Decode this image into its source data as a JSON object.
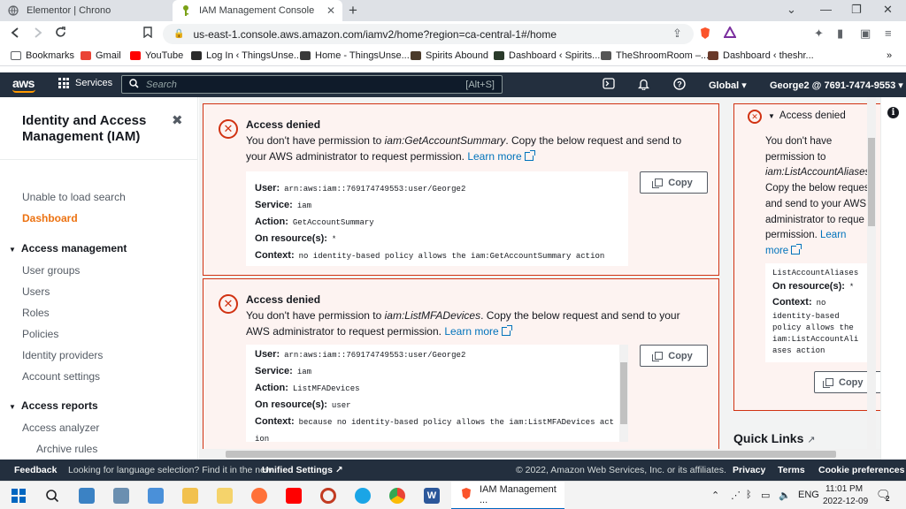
{
  "browser": {
    "tabs": [
      {
        "title": "Elementor | Chrono",
        "active": false
      },
      {
        "title": "IAM Management Console",
        "active": true
      }
    ],
    "new_tab": "+",
    "url": "us-east-1.console.aws.amazon.com/iamv2/home?region=ca-central-1#/home",
    "bookmarks": [
      {
        "label": "Bookmarks",
        "color": "#5f6368"
      },
      {
        "label": "Gmail",
        "color": "#ea4335"
      },
      {
        "label": "YouTube",
        "color": "#ff0000"
      },
      {
        "label": "Log In ‹ ThingsUnse...",
        "color": "#2b2b2b"
      },
      {
        "label": "Home - ThingsUnse...",
        "color": "#3a3a3a"
      },
      {
        "label": "Spirits Abound",
        "color": "#4a3a2a"
      },
      {
        "label": "Dashboard ‹ Spirits...",
        "color": "#2a3a2a"
      },
      {
        "label": "TheShroomRoom –...",
        "color": "#555555"
      },
      {
        "label": "Dashboard ‹ theshr...",
        "color": "#6a3a2a"
      }
    ],
    "more_bookmarks": "»"
  },
  "aws_nav": {
    "logo": "aws",
    "services": "Services",
    "search_placeholder": "Search",
    "search_shortcut": "[Alt+S]",
    "region": "Global ▾",
    "account": "George2 @ 7691-7474-9553 ▾"
  },
  "sidebar": {
    "title": "Identity and Access Management (IAM)",
    "close": "✖",
    "unable": "Unable to load search",
    "dashboard": "Dashboard",
    "access_management": "Access management",
    "am_items": [
      "User groups",
      "Users",
      "Roles",
      "Policies",
      "Identity providers",
      "Account settings"
    ],
    "access_reports": "Access reports",
    "ar_items": [
      "Access analyzer"
    ],
    "ar_sub_items": [
      "Archive rules"
    ]
  },
  "alerts": [
    {
      "title": "Access denied",
      "msg_pre": "You don't have permission to ",
      "action": "iam:GetAccountSummary",
      "msg_post": ". Copy the below request and send to your AWS administrator to request permission.",
      "link": "Learn more",
      "user_label": "User:",
      "user": "arn:aws:iam::769174749553:user/George2",
      "service_label": "Service:",
      "service": "iam",
      "action_label": "Action:",
      "action_value": "GetAccountSummary",
      "resource_label": "On resource(s):",
      "resource": "*",
      "context_label": "Context:",
      "context": "no identity-based policy allows the iam:GetAccountSummary action",
      "copy": "Copy"
    },
    {
      "title": "Access denied",
      "msg_pre": "You don't have permission to ",
      "action": "iam:ListMFADevices",
      "msg_post": ". Copy the below request and send to your AWS administrator to request permission.",
      "link": "Learn more",
      "user_label": "User:",
      "user": "arn:aws:iam::769174749553:user/George2",
      "service_label": "Service:",
      "service": "iam",
      "action_label": "Action:",
      "action_value": "ListMFADevices",
      "resource_label": "On resource(s):",
      "resource": "user",
      "context_label": "Context:",
      "context_line1": "because no identity-based policy allows the iam:ListMFADevices act",
      "context_line2": "ion",
      "copy": "Copy"
    }
  ],
  "side_alert": {
    "title": "Access denied",
    "msg1": "You don't have",
    "msg2": "permission to",
    "action": "iam:ListAccountAliases",
    "msg3": "Copy the below reques",
    "msg4": "and send to your AWS",
    "msg5": "administrator to reque",
    "msg6": "permission.",
    "link1": "Learn",
    "link2": "more",
    "code_top": "ListAccountAliases",
    "resource_label": "On resource(s):",
    "resource": "*",
    "context_label": "Context:",
    "context_lines": [
      "no",
      "identity-based",
      "policy allows the",
      "iam:ListAccountAli",
      "ases action"
    ],
    "copy": "Copy"
  },
  "quick_links": "Quick Links",
  "footer": {
    "feedback": "Feedback",
    "lang": "Looking for language selection? Find it in the new",
    "unified": "Unified Settings",
    "copyright": "© 2022, Amazon Web Services, Inc. or its affiliates.",
    "privacy": "Privacy",
    "terms": "Terms",
    "cookies": "Cookie preferences"
  },
  "taskbar": {
    "active_window": "IAM Management ...",
    "lang": "ENG",
    "time": "11:01 PM",
    "date": "2022-12-09",
    "notifications": "2"
  }
}
